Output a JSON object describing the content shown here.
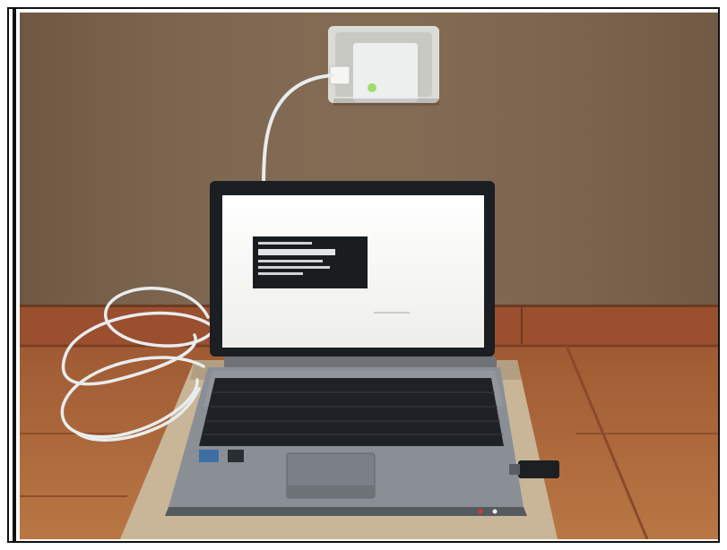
{
  "scene": {
    "description_subjects": [
      "wall-socket",
      "powerline-adapter",
      "ethernet-cable",
      "laptop",
      "laptop-screen",
      "keyboard",
      "touchpad",
      "usb-wireless-dongle",
      "floor-tiles",
      "mat"
    ],
    "colors": {
      "wall": "#7d644c",
      "wall_shadow": "#6d5541",
      "baseboard": "#9a4f2f",
      "floor": "#b06a3d",
      "floor_dark": "#8e4e2b",
      "mat": "#c9b597",
      "laptop_body": "#6f7378",
      "laptop_deck": "#8a8f95",
      "keyboard": "#1e2226",
      "screen": "#f7f7f4",
      "terminal": "#1a1d1f",
      "cable": "#e9ecee",
      "adapter": "#ecefed",
      "socket_plate": "#dcdcd7",
      "led_green": "#9ede6b",
      "led_red": "#e3342f"
    }
  }
}
